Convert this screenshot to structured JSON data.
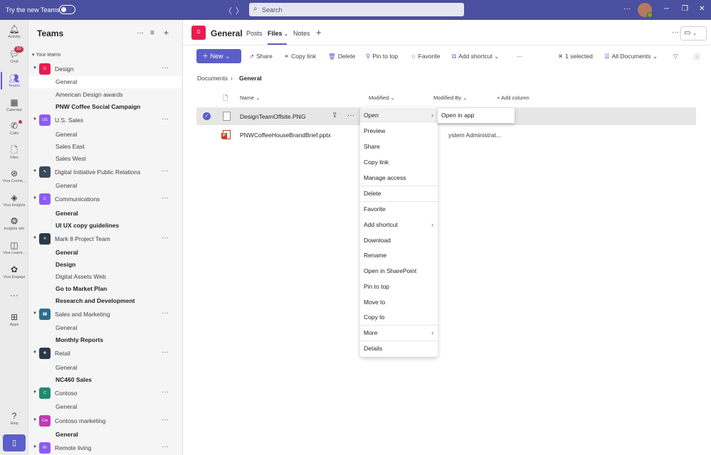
{
  "titlebar": {
    "try_label": "Try the new Teams",
    "search_placeholder": "Search",
    "more": "···",
    "minimize": "─",
    "maximize": "❐",
    "close": "✕",
    "back": "〈",
    "forward": "〉"
  },
  "rail": {
    "items": [
      {
        "label": "Activity",
        "icon": "bell-icon"
      },
      {
        "label": "Chat",
        "icon": "chat-icon",
        "badge": "10"
      },
      {
        "label": "Teams",
        "icon": "teams-icon"
      },
      {
        "label": "Calendar",
        "icon": "calendar-icon"
      },
      {
        "label": "Calls",
        "icon": "phone-icon"
      },
      {
        "label": "Files",
        "icon": "file-icon"
      },
      {
        "label": "Viva Conne...",
        "icon": "viva-connections-icon"
      },
      {
        "label": "Viva Insights",
        "icon": "viva-insights-icon"
      },
      {
        "label": "Insights sim",
        "icon": "insights-sim-icon"
      },
      {
        "label": "Viva Learni...",
        "icon": "viva-learning-icon"
      },
      {
        "label": "Viva Engage",
        "icon": "viva-engage-icon"
      },
      {
        "label": "···",
        "icon": "more-apps-icon"
      },
      {
        "label": "Apps",
        "icon": "apps-icon"
      },
      {
        "label": "Help",
        "icon": "help-icon"
      }
    ]
  },
  "teams_panel": {
    "title": "Teams",
    "your_teams": "Your teams",
    "teams": [
      {
        "name": "Design",
        "initial": "D",
        "color": "#e81c4f",
        "channels": [
          {
            "name": "General",
            "bold": false,
            "selected": true
          },
          {
            "name": "American Design awards",
            "bold": false
          },
          {
            "name": "PNW Coffee Social Campaign",
            "bold": true
          }
        ]
      },
      {
        "name": "U.S. Sales",
        "initial": "US",
        "color": "#8b5cf6",
        "channels": [
          {
            "name": "General",
            "bold": false
          },
          {
            "name": "Sales East",
            "bold": false
          },
          {
            "name": "Sales West",
            "bold": false
          }
        ]
      },
      {
        "name": "Digital Initiative Public Relations",
        "initial": "",
        "color": "#3a4a5a",
        "channels": [
          {
            "name": "General",
            "bold": false
          }
        ]
      },
      {
        "name": "Communications",
        "initial": "C",
        "color": "#8b5cf6",
        "channels": [
          {
            "name": "General",
            "bold": true
          },
          {
            "name": "UI UX copy guidelines",
            "bold": true
          }
        ]
      },
      {
        "name": "Mark 8 Project Team",
        "initial": "",
        "color": "#2b3a4a",
        "channels": [
          {
            "name": "General",
            "bold": true
          },
          {
            "name": "Design",
            "bold": true
          },
          {
            "name": "Digital Assets Web",
            "bold": false
          },
          {
            "name": "Go to Market Plan",
            "bold": true
          },
          {
            "name": "Research and Development",
            "bold": true
          }
        ]
      },
      {
        "name": "Sales and Marketing",
        "initial": "",
        "color": "#2e6d8e",
        "channels": [
          {
            "name": "General",
            "bold": false
          },
          {
            "name": "Monthly Reports",
            "bold": true
          }
        ]
      },
      {
        "name": "Retail",
        "initial": "",
        "color": "#2b3a4a",
        "channels": [
          {
            "name": "General",
            "bold": false
          },
          {
            "name": "NC460 Sales",
            "bold": true
          }
        ]
      },
      {
        "name": "Contoso",
        "initial": "C",
        "color": "#1f8a70",
        "channels": [
          {
            "name": "General",
            "bold": false
          }
        ]
      },
      {
        "name": "Contoso marketing",
        "initial": "Cm",
        "color": "#c239b3",
        "channels": [
          {
            "name": "General",
            "bold": true
          }
        ]
      },
      {
        "name": "Remote living",
        "initial": "RI",
        "color": "#8b5cf6",
        "channels": []
      }
    ]
  },
  "channel": {
    "initial": "D",
    "name": "General",
    "tabs": [
      "Posts",
      "Files",
      "Notes"
    ],
    "active_tab": "Files",
    "add_tab": "+"
  },
  "commands": {
    "new": "New",
    "share": "Share",
    "copy_link": "Copy link",
    "delete": "Delete",
    "pin": "Pin to top",
    "favorite": "Favorite",
    "add_shortcut": "Add shortcut",
    "more": "···",
    "selected": "1 selected",
    "view": "All Documents"
  },
  "breadcrumb": {
    "root": "Documents",
    "current": "General",
    "sep": "›"
  },
  "columns": {
    "name": "Name",
    "modified": "Modified",
    "modified_by": "Modified By",
    "add_column": "+ Add column"
  },
  "files": [
    {
      "name": "DesignTeamOffsite.PNG",
      "modified_by": "",
      "selected": true,
      "type": "png"
    },
    {
      "name": "PNWCoffeeHouseBrandBrief.pptx",
      "modified_by": "ystem Administrat...",
      "selected": false,
      "type": "pptx"
    }
  ],
  "context_menu": {
    "items": [
      "Open",
      "Preview",
      "Share",
      "Copy link",
      "Manage access",
      "Delete",
      "Favorite",
      "Add shortcut",
      "Download",
      "Rename",
      "Open in SharePoint",
      "Pin to top",
      "Move to",
      "Copy to",
      "More",
      "Details"
    ],
    "submenu": "Open in app"
  }
}
